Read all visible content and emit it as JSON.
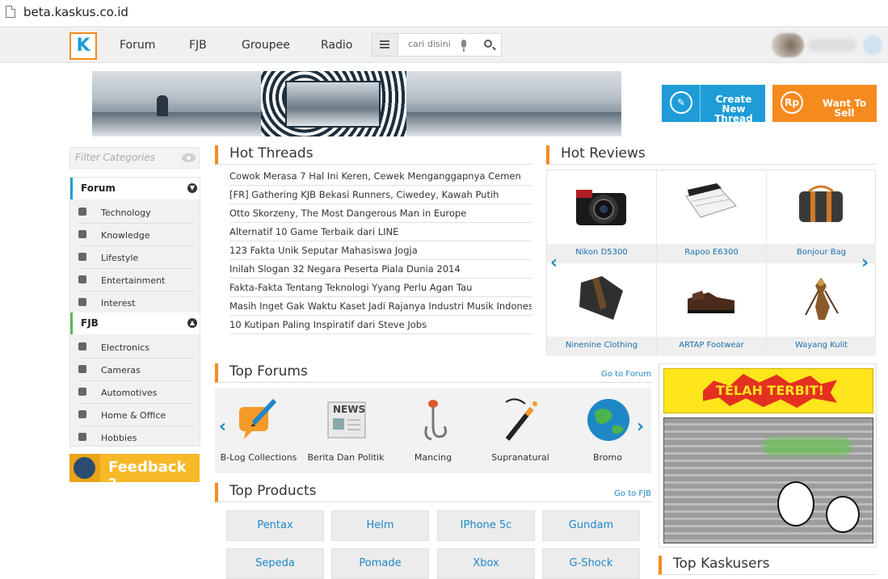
{
  "browser": {
    "url": "beta.kaskus.co.id"
  },
  "nav": {
    "logo": "K",
    "links": [
      "Forum",
      "FJB",
      "Groupee",
      "Radio"
    ],
    "search_placeholder": "cari disini"
  },
  "cta": {
    "create_thread": "Create New Thread",
    "want_to_sell": "Want To Sell",
    "rp": "Rp"
  },
  "sidebar": {
    "filter_placeholder": "Filter Categories",
    "forum_title": "Forum",
    "forum_items": [
      "Technology",
      "Knowledge",
      "Lifestyle",
      "Entertainment",
      "Interest"
    ],
    "fjb_title": "FJB",
    "fjb_items": [
      "Electronics",
      "Cameras",
      "Automotives",
      "Home & Office",
      "Hobbies"
    ],
    "feedback": "Feedback ?"
  },
  "hot_threads": {
    "title": "Hot Threads",
    "items": [
      "Cowok Merasa 7 Hal Ini Keren, Cewek Menganggapnya Cemen",
      "[FR] Gathering KJB Bekasi Runners, Ciwedey, Kawah Putih",
      "Otto Skorzeny, The Most Dangerous Man in Europe",
      "Alternatif 10 Game Terbaik dari LINE",
      "123 Fakta Unik Seputar Mahasiswa Jogja",
      "Inilah Slogan 32 Negara Peserta Piala Dunia 2014",
      "Fakta-Fakta Tentang Teknologi Yyang Perlu Agan Tau",
      "Masih Inget Gak Waktu Kaset Jadi Rajanya Industri Musik Indonesia?",
      "10 Kutipan Paling Inspiratif dari Steve Jobs"
    ]
  },
  "hot_reviews": {
    "title": "Hot Reviews",
    "items": [
      "Nikon D5300",
      "Rapoo E6300",
      "Bonjour Bag",
      "Ninenine Clothing",
      "ARTAP Footwear",
      "Wayang Kulit"
    ]
  },
  "top_forums": {
    "title": "Top Forums",
    "link": "Go to Forum",
    "items": [
      "B-Log Collections",
      "Berita Dan Politik",
      "Mancing",
      "Supranatural",
      "Bromo"
    ],
    "news_badge": "NEWS"
  },
  "top_products": {
    "title": "Top Products",
    "link": "Go to FJB",
    "items": [
      "Pentax",
      "Helm",
      "IPhone 5c",
      "Gundam",
      "Sepeda",
      "Pomade",
      "Xbox",
      "G-Shock"
    ]
  },
  "ad": {
    "headline": "TELAH TERBIT!"
  },
  "top_kaskusers": {
    "title": "Top Kaskusers"
  },
  "colors": {
    "accent_blue": "#1e9cd7",
    "accent_orange": "#f58b1f",
    "feedback_yellow": "#f7b928"
  }
}
